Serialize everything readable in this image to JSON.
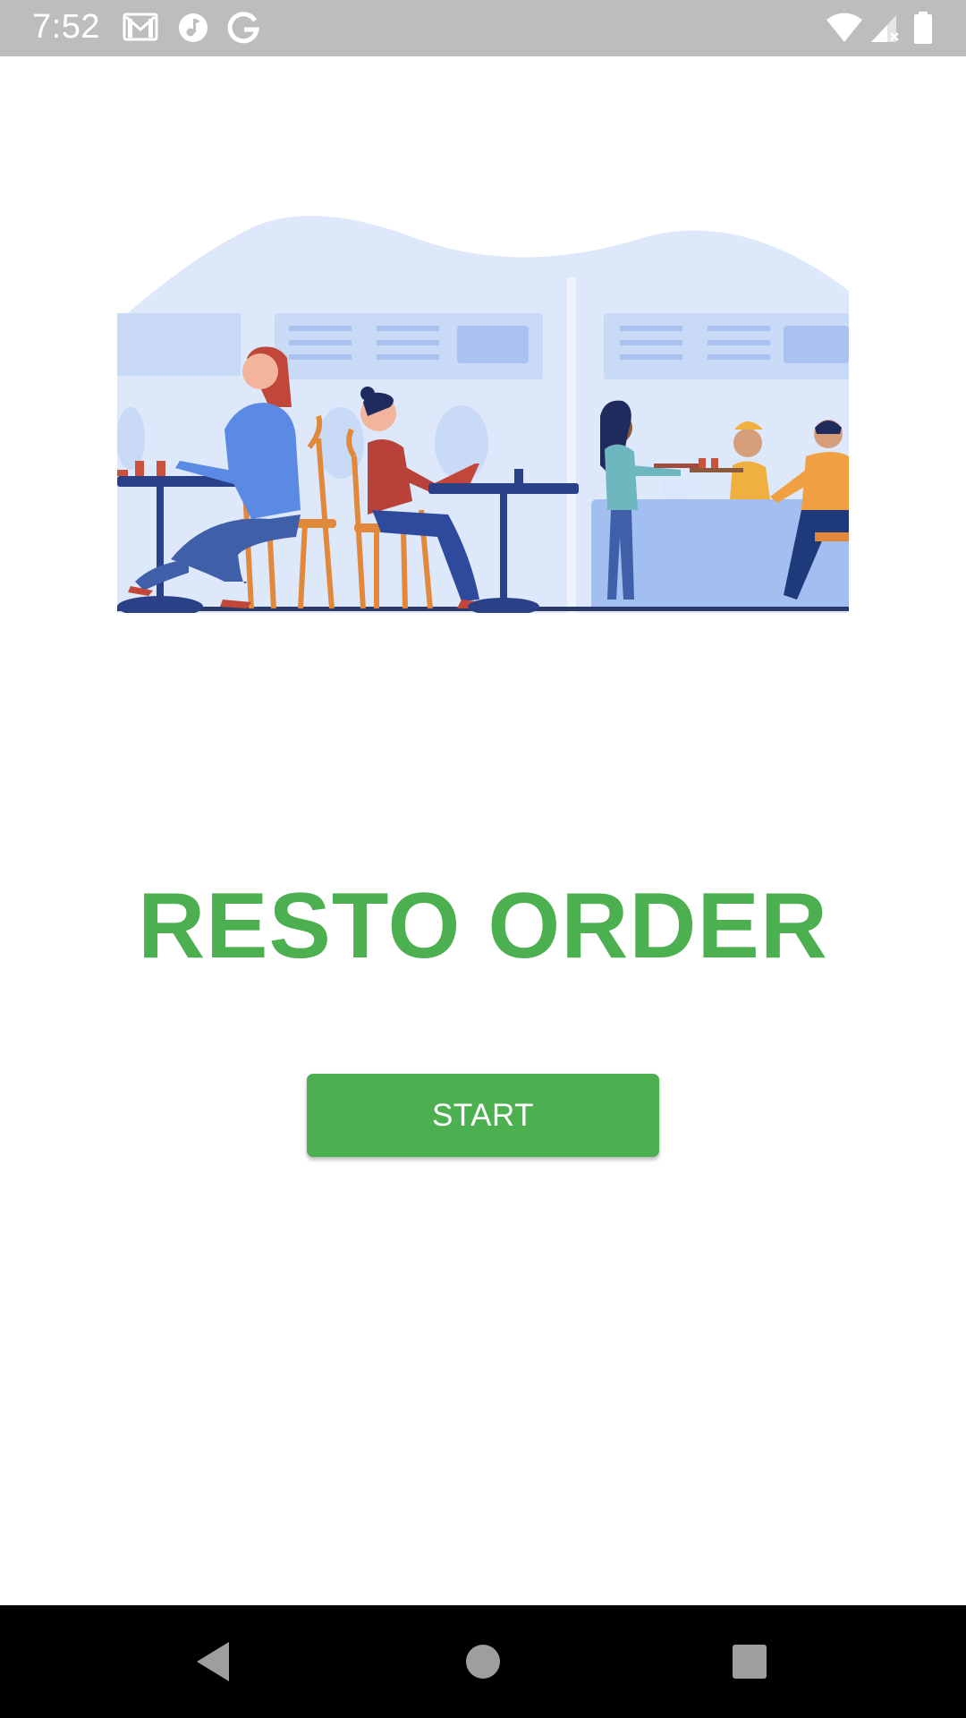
{
  "status_bar": {
    "time": "7:52",
    "icons": [
      "gmail-icon",
      "music-icon",
      "google-icon",
      "wifi-icon",
      "signal-icon",
      "battery-icon"
    ],
    "background": "#bdbdbd"
  },
  "hero": {
    "image": "restaurant-illustration"
  },
  "main": {
    "title": "RESTO ORDER",
    "start_label": "START",
    "accent_color": "#4caf50"
  },
  "nav_bar": {
    "buttons": [
      "back-icon",
      "home-icon",
      "recents-icon"
    ]
  }
}
